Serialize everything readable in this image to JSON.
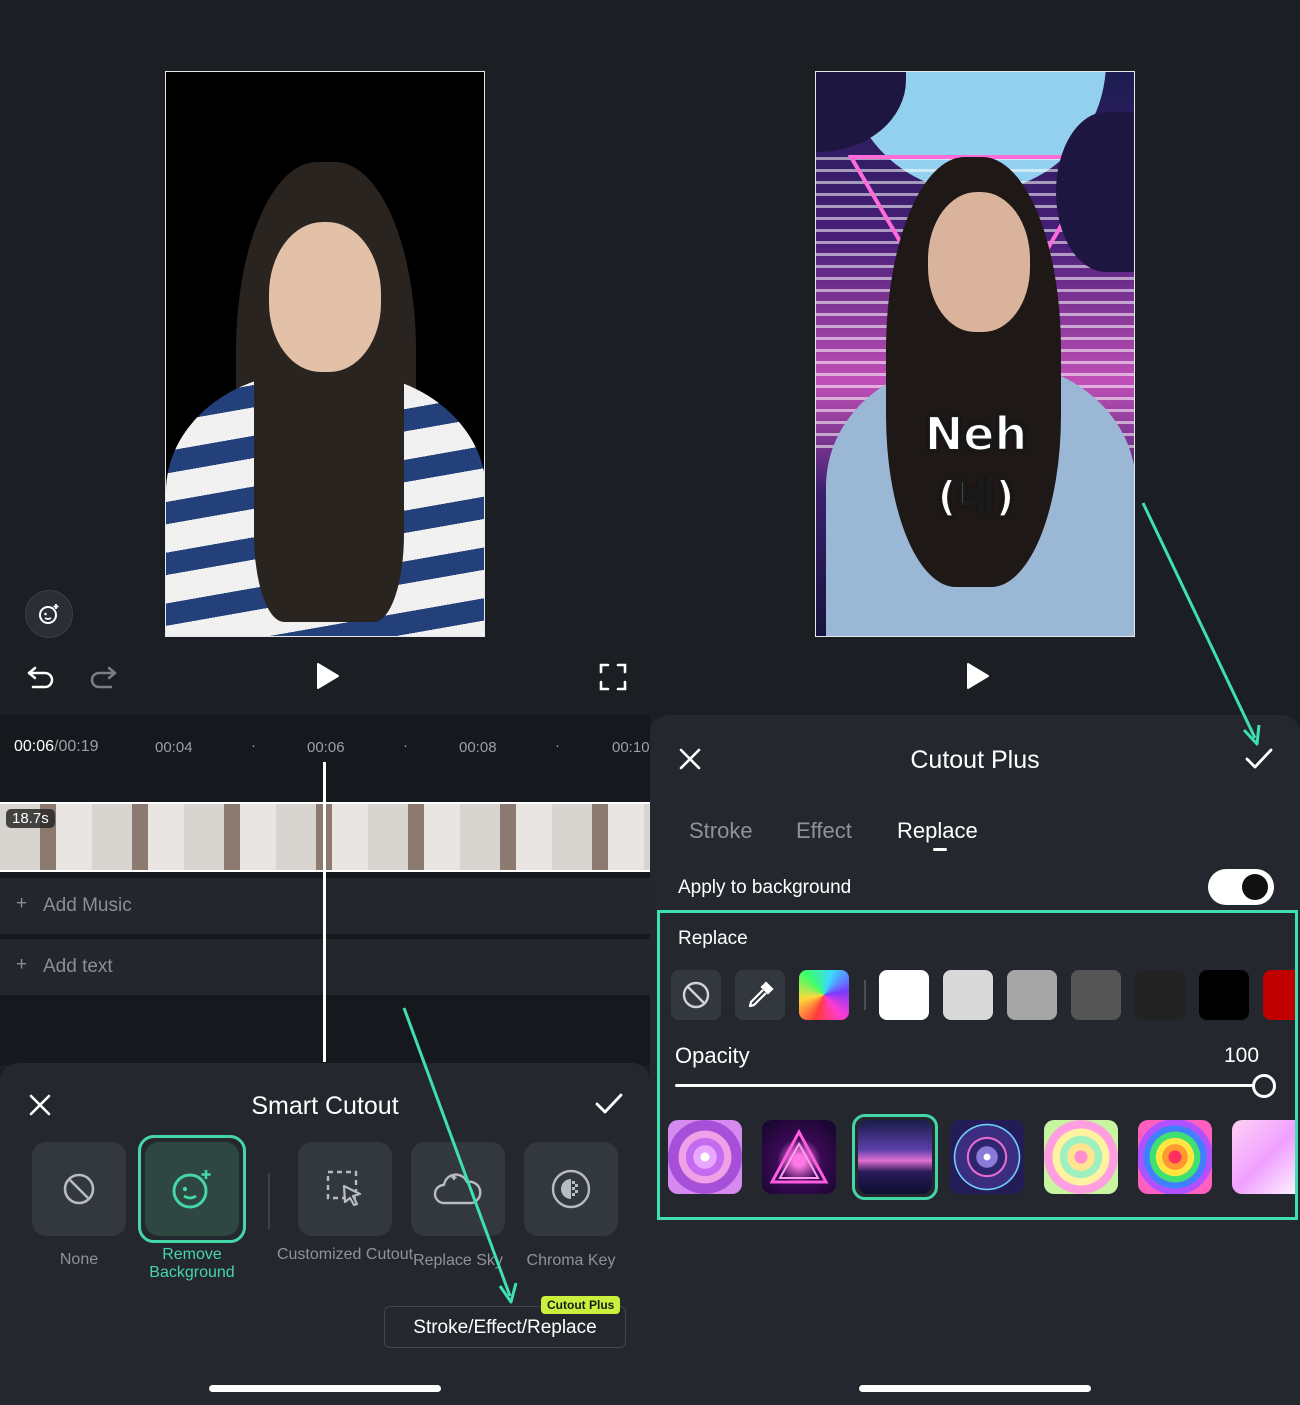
{
  "left": {
    "timecode_current": "00:06",
    "timecode_total": "/00:19",
    "ruler_marks": [
      "00:04",
      "00:06",
      "00:08",
      "00:10"
    ],
    "clip_duration": "18.7s",
    "tracks": {
      "add_music": "Add Music",
      "add_text": "Add text"
    },
    "sheet": {
      "title": "Smart Cutout",
      "tools": [
        {
          "label": "None",
          "icon": "prohibit-icon"
        },
        {
          "label": "Remove Background",
          "icon": "remove-background-icon"
        },
        {
          "label": "Customized Cutout",
          "icon": "customized-cutout-icon"
        },
        {
          "label": "Replace Sky",
          "icon": "cloud-icon"
        },
        {
          "label": "Chroma Key",
          "icon": "chroma-key-icon"
        }
      ],
      "cutout_badge": "Cutout Plus",
      "cutout_button": "Stroke/Effect/Replace"
    }
  },
  "right": {
    "caption_line1": "Neh",
    "caption_line2": "(네)",
    "sheet": {
      "title": "Cutout Plus",
      "tabs": [
        "Stroke",
        "Effect",
        "Replace"
      ],
      "active_tab": "Replace",
      "apply_to_background": "Apply to background",
      "apply_enabled": true,
      "section_replace": "Replace",
      "swatches": [
        "#ffffff",
        "#d9d9d9",
        "#a6a6a6",
        "#555555",
        "#222222",
        "#000000",
        "#c00000"
      ],
      "opacity_label": "Opacity",
      "opacity_value": "100",
      "opacity_fraction": 1.0
    }
  },
  "colors": {
    "accent": "#45d6a8",
    "arrow": "#3fe0b0",
    "bg": "#1b1e23"
  }
}
